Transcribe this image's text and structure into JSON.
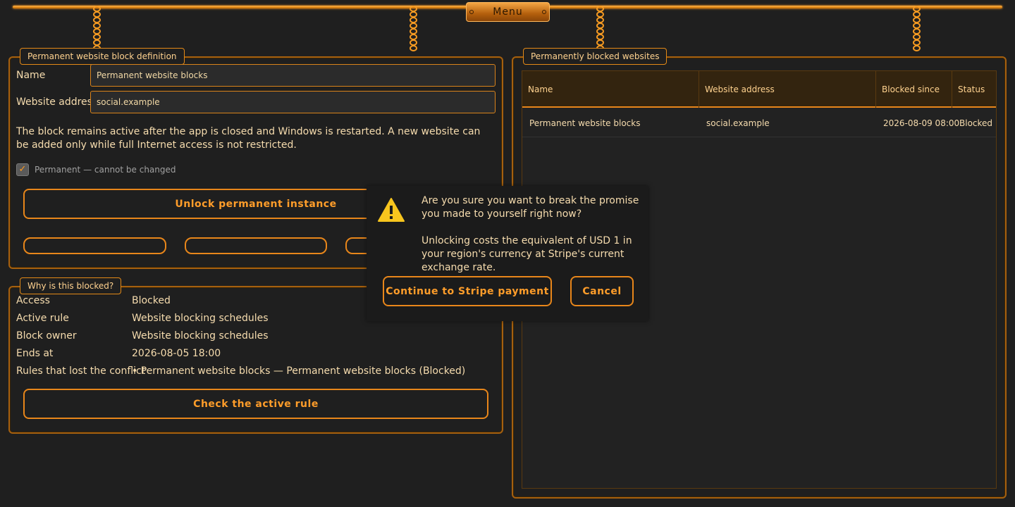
{
  "menu": {
    "label": "Menu"
  },
  "definition_panel": {
    "legend": "Permanent website block definition",
    "name_label": "Name",
    "name_value": "Permanent website blocks",
    "address_label": "Website address",
    "address_value": "social.example",
    "info": "The block remains active after the app is closed and Windows is restarted. A new website can be added only while full Internet access is not restricted.",
    "permanent_checkbox_label": "Permanent — cannot be changed",
    "unlock_button": "Unlock permanent instance"
  },
  "why_panel": {
    "legend": "Why is this blocked?",
    "rows": [
      {
        "key": "Access",
        "value": "Blocked"
      },
      {
        "key": "Active rule",
        "value": "Website blocking schedules"
      },
      {
        "key": "Block owner",
        "value": "Website blocking schedules"
      },
      {
        "key": "Ends at",
        "value": "2026-08-05 18:00"
      },
      {
        "key": "Rules that lost the conflict",
        "value": "• Permanent website blocks — Permanent website blocks (Blocked)"
      }
    ],
    "check_button": "Check the active rule"
  },
  "blocked_panel": {
    "legend": "Permanently blocked websites",
    "columns": [
      "Name",
      "Website address",
      "Blocked since",
      "Status"
    ],
    "rows": [
      [
        "Permanent website blocks",
        "social.example",
        "2026-08-09 08:00",
        "Blocked"
      ]
    ]
  },
  "dialog": {
    "message1": "Are you sure you want to break the promise you made to yourself right now?",
    "message2": "Unlocking costs the equivalent of USD 1 in your region's currency at Stripe's current exchange rate.",
    "continue_button": "Continue to Stripe payment",
    "cancel_button": "Cancel",
    "icon": "warning-icon"
  },
  "colors": {
    "accent": "#e8861a",
    "background": "#1f1f1f",
    "text": "#f6dcae",
    "warning": "#f7c51e"
  }
}
